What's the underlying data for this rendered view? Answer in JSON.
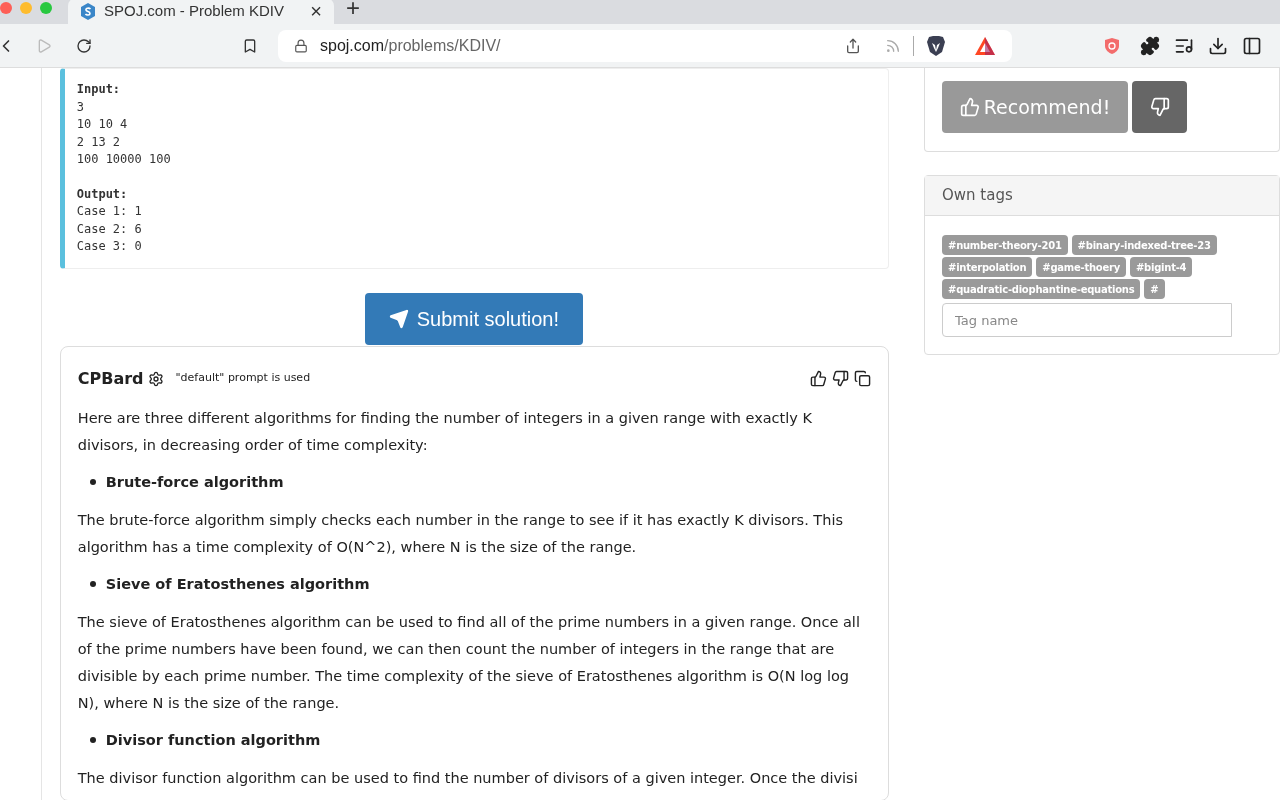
{
  "browser": {
    "tab": {
      "title": "SPOJ.com - Problem KDIV",
      "close": "×",
      "selected": true
    },
    "new_tab": "+",
    "url": {
      "host": "spoj.com",
      "path": "/problems/KDIV/"
    }
  },
  "example": {
    "sections": [
      {
        "heading": "Input:",
        "lines": [
          "3",
          "10 10 4",
          "2 13 2",
          "100 10000 100"
        ]
      },
      {
        "heading": "Output:",
        "lines": [
          "Case 1: 1",
          "Case 2: 6",
          "Case 3: 0"
        ]
      }
    ]
  },
  "submit_button": "Submit solution!",
  "cpbard": {
    "title": "CPBard",
    "note": "\"default\" prompt is used",
    "blocks": [
      {
        "kind": "paragraph",
        "text": "Here are three different algorithms for finding the number of integers in a given range with exactly K divisors, in decreasing order of time complexity:"
      },
      {
        "kind": "bullet",
        "text": "Brute-force algorithm"
      },
      {
        "kind": "paragraph",
        "text": "The brute-force algorithm simply checks each number in the range to see if it has exactly K divisors. This algorithm has a time complexity of O(N^2), where N is the size of the range."
      },
      {
        "kind": "bullet",
        "text": "Sieve of Eratosthenes algorithm"
      },
      {
        "kind": "paragraph",
        "text": "The sieve of Eratosthenes algorithm can be used to find all of the prime numbers in a given range. Once all of the prime numbers have been found, we can then count the number of integers in the range that are divisible by each prime number. The time complexity of the sieve of Eratosthenes algorithm is O(N log log N), where N is the size of the range."
      },
      {
        "kind": "bullet",
        "text": "Divisor function algorithm"
      },
      {
        "kind": "paragraph",
        "text": "The divisor function algorithm can be used to find the number of divisors of a given integer. Once the divisi"
      }
    ]
  },
  "recommend": {
    "label": "Recommend!"
  },
  "own_tags": {
    "title": "Own tags",
    "tags": [
      "#number-theory-201",
      "#binary-indexed-tree-23",
      "#interpolation",
      "#game-thoery",
      "#bigint-4",
      "#quadratic-diophantine-equations",
      "#"
    ],
    "input": {
      "placeholder": "Tag name"
    }
  }
}
